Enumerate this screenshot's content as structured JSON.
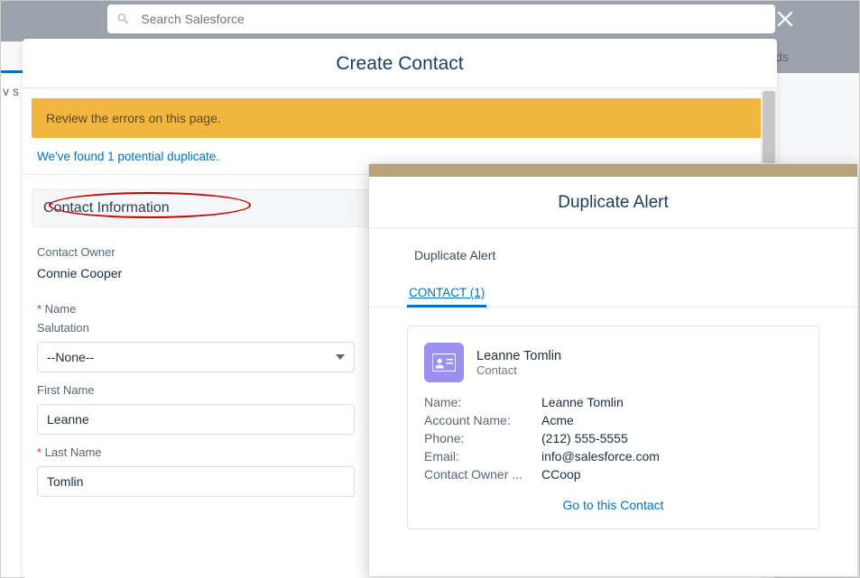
{
  "header": {
    "search_placeholder": "Search Salesforce",
    "right_tab_fragment": "ds",
    "left_fragment": "v s"
  },
  "modal": {
    "title": "Create Contact",
    "warning": "Review the errors on this page.",
    "duplicate_link": "We've found 1 potential duplicate.",
    "section_title": "Contact Information",
    "owner_label": "Contact Owner",
    "owner_value": "Connie Cooper",
    "name_label": "Name",
    "salutation_label": "Salutation",
    "salutation_value": "--None--",
    "first_name_label": "First Name",
    "first_name_value": "Leanne",
    "last_name_label": "Last Name",
    "last_name_value": "Tomlin"
  },
  "alert": {
    "title": "Duplicate Alert",
    "subtitle": "Duplicate Alert",
    "tab_label": "CONTACT (1)",
    "card": {
      "name": "Leanne Tomlin",
      "object": "Contact",
      "fields": [
        {
          "k": "Name:",
          "v": "Leanne Tomlin"
        },
        {
          "k": "Account Name:",
          "v": "Acme"
        },
        {
          "k": "Phone:",
          "v": "(212) 555-5555"
        },
        {
          "k": "Email:",
          "v": "info@salesforce.com"
        },
        {
          "k": "Contact Owner ...",
          "v": "CCoop"
        }
      ],
      "goto": "Go to this Contact"
    }
  }
}
